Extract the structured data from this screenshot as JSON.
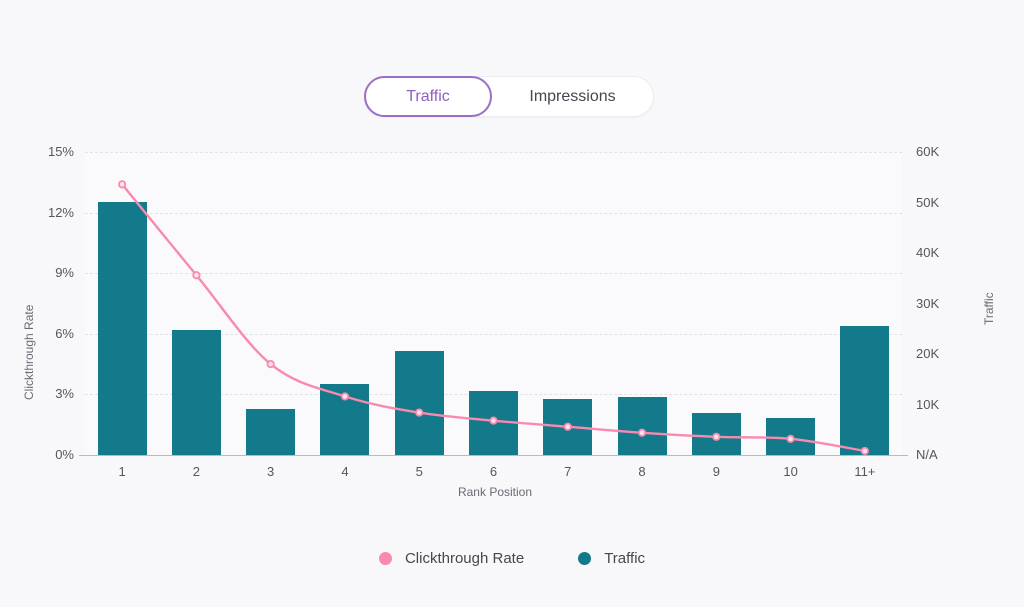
{
  "toggle": {
    "options": [
      {
        "label": "Traffic",
        "selected": true
      },
      {
        "label": "Impressions",
        "selected": false
      }
    ]
  },
  "colors": {
    "traffic_bar": "#127a8a",
    "ctr_line": "#f98aae",
    "accent_purple": "#9a6fc7",
    "page_background": "#f8f8fb",
    "plot_background": "#fafafc",
    "gridline": "#e2e2e8"
  },
  "legend": [
    {
      "label": "Clickthrough Rate",
      "color": "#f98aae"
    },
    {
      "label": "Traffic",
      "color": "#127a8a"
    }
  ],
  "chart_data": {
    "type": "bar",
    "title": "",
    "xlabel": "Rank Position",
    "ylabel": "Clickthrough Rate",
    "y2label": "Traffic",
    "grid": true,
    "legend_position": "bottom",
    "categories": [
      "1",
      "2",
      "3",
      "4",
      "5",
      "6",
      "7",
      "8",
      "9",
      "10",
      "11+"
    ],
    "yticks": [
      "0%",
      "3%",
      "6%",
      "9%",
      "12%",
      "15%"
    ],
    "ytick_values": [
      0,
      3,
      6,
      9,
      12,
      15
    ],
    "ylim": [
      0,
      15
    ],
    "y2ticks": [
      "N/A",
      "10K",
      "20K",
      "30K",
      "40K",
      "50K",
      "60K"
    ],
    "y2tick_values": [
      0,
      10000,
      20000,
      30000,
      40000,
      50000,
      60000
    ],
    "y2lim": [
      0,
      60000
    ],
    "series": [
      {
        "name": "Traffic",
        "type": "bar",
        "axis": "right",
        "color": "#127a8a",
        "values": [
          50200,
          24800,
          9200,
          14000,
          20500,
          12700,
          11000,
          11400,
          8400,
          7400,
          25600
        ]
      },
      {
        "name": "Clickthrough Rate",
        "type": "line",
        "axis": "left",
        "color": "#f98aae",
        "values": [
          13.4,
          8.9,
          4.5,
          2.9,
          2.1,
          1.7,
          1.4,
          1.1,
          0.9,
          0.8,
          0.2
        ]
      }
    ]
  }
}
